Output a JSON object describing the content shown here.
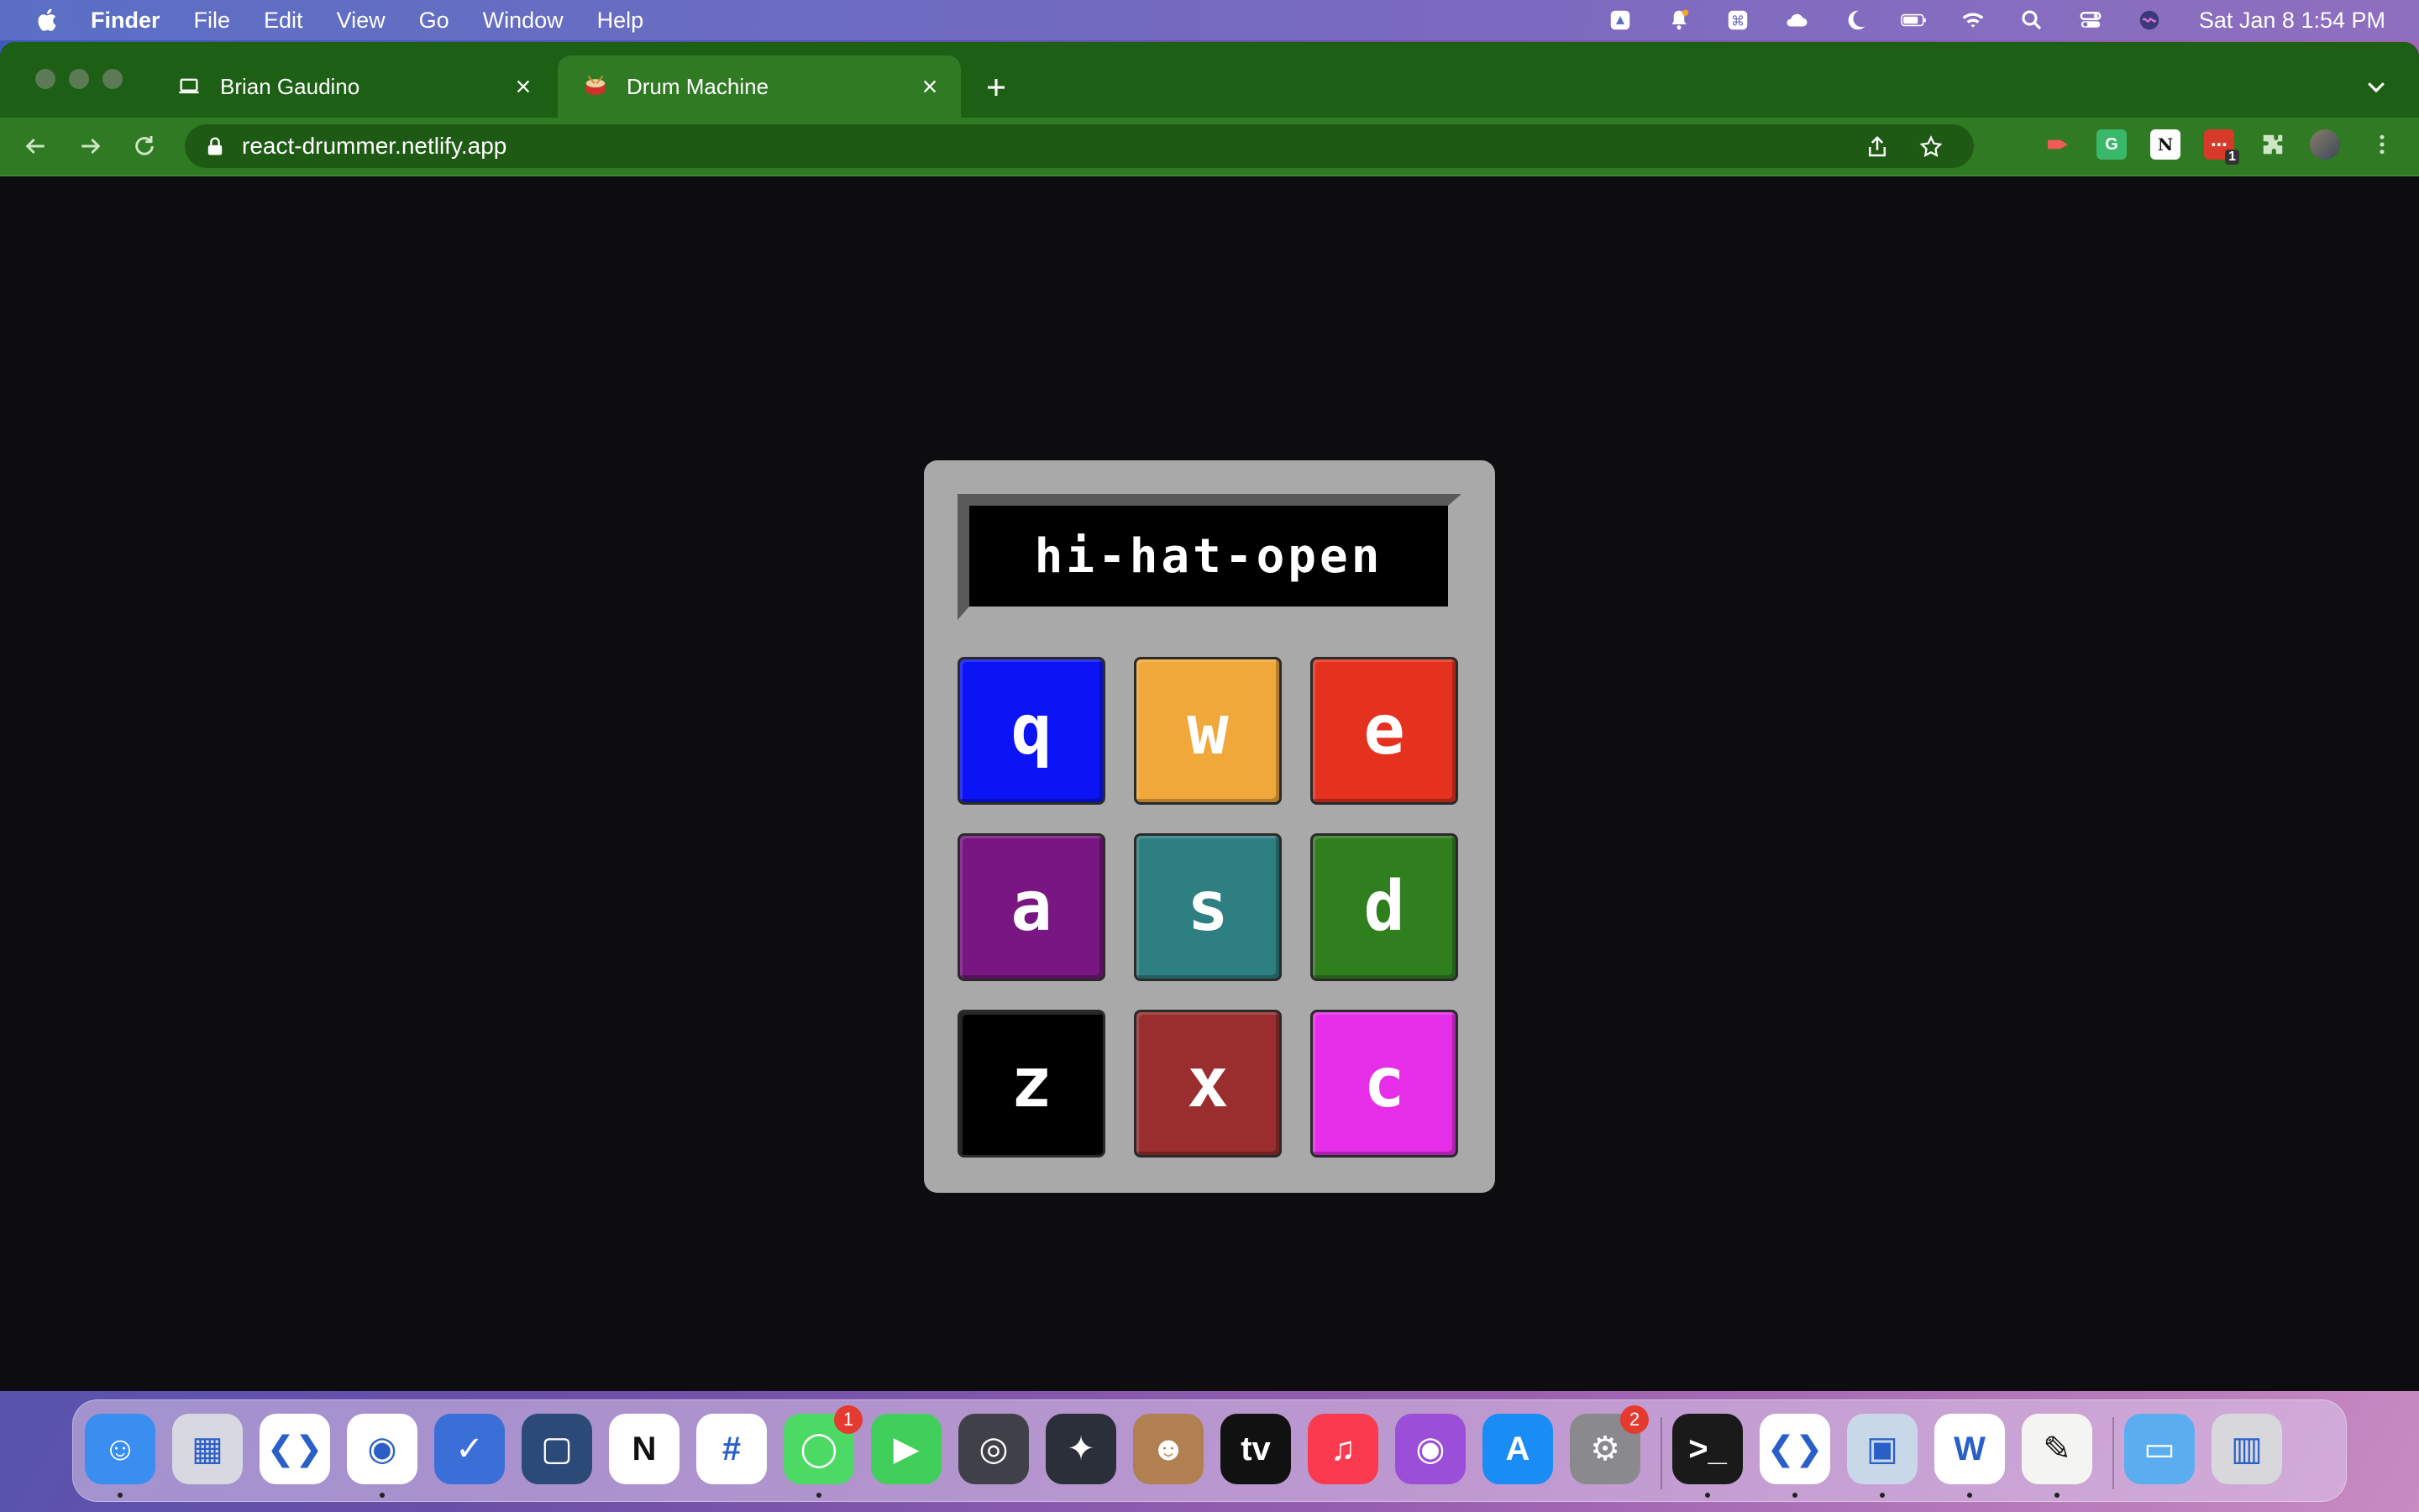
{
  "menubar": {
    "app_name": "Finder",
    "items": [
      "File",
      "Edit",
      "View",
      "Go",
      "Window",
      "Help"
    ],
    "clock": "Sat Jan 8  1:54 PM",
    "status_icons": [
      "google-drive-icon",
      "notifications-icon",
      "keyboard-shortcut-icon",
      "cloud-icon",
      "moon-icon",
      "battery-icon",
      "wifi-icon",
      "search-icon",
      "control-center-icon",
      "siri-icon"
    ]
  },
  "browser": {
    "tabs": [
      {
        "title": "Brian Gaudino",
        "icon": "laptop-icon",
        "active": false
      },
      {
        "title": "Drum Machine",
        "icon": "drum-icon",
        "active": true
      }
    ],
    "url": "react-drummer.netlify.app",
    "extensions_badge": "1"
  },
  "drum_machine": {
    "display_text": "hi-hat-open",
    "pads": [
      {
        "key": "q",
        "color": "#0a14f5"
      },
      {
        "key": "w",
        "color": "#f0a83a"
      },
      {
        "key": "e",
        "color": "#e5321e"
      },
      {
        "key": "a",
        "color": "#781682"
      },
      {
        "key": "s",
        "color": "#2e7f82"
      },
      {
        "key": "d",
        "color": "#2f7f1e"
      },
      {
        "key": "z",
        "color": "#000000"
      },
      {
        "key": "x",
        "color": "#9a2e2e"
      },
      {
        "key": "c",
        "color": "#e62ee8"
      }
    ]
  },
  "dock": {
    "apps": [
      {
        "name": "Finder",
        "icon": "finder-icon",
        "color": "#3a8ef0",
        "running": true
      },
      {
        "name": "Launchpad",
        "icon": "launchpad-icon",
        "color": "#d8d8e0",
        "running": false
      },
      {
        "name": "Visual Studio Code",
        "icon": "vscode-icon",
        "color": "#ffffff",
        "running": false
      },
      {
        "name": "Google Chrome",
        "icon": "chrome-icon",
        "color": "#ffffff",
        "running": true
      },
      {
        "name": "Things",
        "icon": "tasks-icon",
        "color": "#3a6fd8",
        "running": false
      },
      {
        "name": "Screens",
        "icon": "screens-icon",
        "color": "#2c4a78",
        "running": false
      },
      {
        "name": "Notion",
        "icon": "notion-icon",
        "color": "#ffffff",
        "running": false
      },
      {
        "name": "Slack",
        "icon": "slack-icon",
        "color": "#ffffff",
        "running": false
      },
      {
        "name": "Messages",
        "icon": "messages-icon",
        "color": "#4cd964",
        "running": true,
        "badge": "1"
      },
      {
        "name": "FaceTime",
        "icon": "facetime-icon",
        "color": "#3fcf5a",
        "running": false
      },
      {
        "name": "Compressor",
        "icon": "compressor-icon",
        "color": "#404048",
        "running": false
      },
      {
        "name": "DaVinci Resolve",
        "icon": "davinci-icon",
        "color": "#2a2f3a",
        "running": false
      },
      {
        "name": "Contacts",
        "icon": "contacts-icon",
        "color": "#b08050",
        "running": false
      },
      {
        "name": "TV",
        "icon": "appletv-icon",
        "color": "#111111",
        "running": false
      },
      {
        "name": "Music",
        "icon": "music-icon",
        "color": "#fa3a4f",
        "running": false
      },
      {
        "name": "Podcasts",
        "icon": "podcasts-icon",
        "color": "#9b4fd8",
        "running": false
      },
      {
        "name": "App Store",
        "icon": "appstore-icon",
        "color": "#1a8cf5",
        "running": false
      },
      {
        "name": "System Preferences",
        "icon": "settings-icon",
        "color": "#8a8a8e",
        "running": false,
        "badge": "2"
      },
      {
        "name": "Terminal",
        "icon": "terminal-icon",
        "color": "#1a1a1a",
        "running": true
      },
      {
        "name": "Visual Studio Code",
        "icon": "vscode-icon",
        "color": "#ffffff",
        "running": true
      },
      {
        "name": "Preview",
        "icon": "preview-icon",
        "color": "#c8d8e8",
        "running": true
      },
      {
        "name": "Microsoft Word",
        "icon": "word-icon",
        "color": "#ffffff",
        "running": true
      },
      {
        "name": "TextEdit",
        "icon": "textedit-icon",
        "color": "#f4f4f0",
        "running": true
      },
      {
        "name": "Downloads",
        "icon": "folder-icon",
        "color": "#5aaef0",
        "running": false
      },
      {
        "name": "Trash",
        "icon": "trash-icon",
        "color": "#d8d8dc",
        "running": false
      }
    ]
  }
}
